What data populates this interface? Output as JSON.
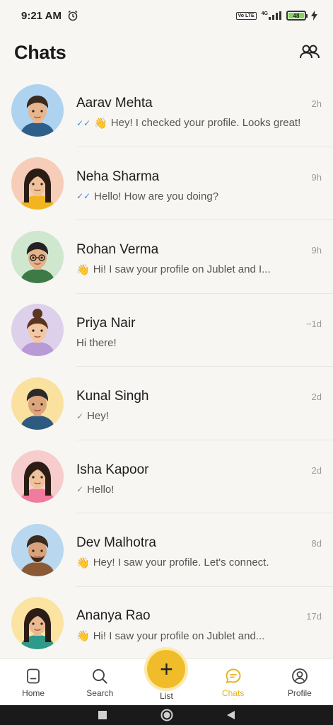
{
  "status_bar": {
    "time": "9:21 AM",
    "alarm_icon": "alarm-icon",
    "volte": "Vo LTE",
    "network": "4G",
    "battery": "48",
    "charging_icon": "bolt-icon"
  },
  "header": {
    "title": "Chats",
    "action_icon": "people-icon"
  },
  "chats": [
    {
      "name": "Aarav Mehta",
      "time": "2h",
      "tick": "double-blue",
      "emoji": "👋",
      "message": "Hey! I checked your profile. Looks great!",
      "avatar_bg": "#aed3f0"
    },
    {
      "name": "Neha Sharma",
      "time": "9h",
      "tick": "double-blue",
      "emoji": "",
      "message": "Hello! How are you doing?",
      "avatar_bg": "#f6cdb8"
    },
    {
      "name": "Rohan Verma",
      "time": "9h",
      "tick": "",
      "emoji": "👋",
      "message": "Hi! I saw your profile on Jublet and I...",
      "avatar_bg": "#cfe6cf"
    },
    {
      "name": "Priya Nair",
      "time": "~1d",
      "tick": "",
      "emoji": "",
      "message": "Hi there!",
      "avatar_bg": "#ddd0ea"
    },
    {
      "name": "Kunal Singh",
      "time": "2d",
      "tick": "single-grey",
      "emoji": "",
      "message": "Hey!",
      "avatar_bg": "#fbe1a0"
    },
    {
      "name": "Isha Kapoor",
      "time": "2d",
      "tick": "single-grey",
      "emoji": "",
      "message": "Hello!",
      "avatar_bg": "#f7cccc"
    },
    {
      "name": "Dev Malhotra",
      "time": "8d",
      "tick": "",
      "emoji": "👋",
      "message": "Hey! I saw your profile. Let's connect.",
      "avatar_bg": "#b9d7ef"
    },
    {
      "name": "Ananya Rao",
      "time": "17d",
      "tick": "",
      "emoji": "👋",
      "message": "Hi! I saw your profile on Jublet and...",
      "avatar_bg": "#fbe3a2"
    }
  ],
  "bottom_nav": {
    "items": [
      {
        "label": "Home",
        "icon": "home-icon"
      },
      {
        "label": "Search",
        "icon": "search-icon"
      },
      {
        "label": "List",
        "icon": "plus-icon"
      },
      {
        "label": "Chats",
        "icon": "chat-icon"
      },
      {
        "label": "Profile",
        "icon": "profile-icon"
      }
    ],
    "active": "Chats",
    "accent": "#f0bc2a"
  },
  "system_nav": {
    "items": [
      "square-icon",
      "circle-icon",
      "back-triangle-icon"
    ]
  }
}
